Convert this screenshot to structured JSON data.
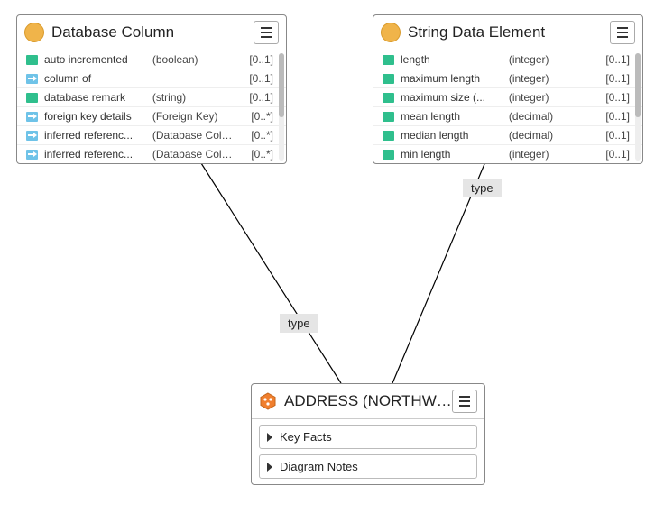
{
  "nodes": {
    "dbcol": {
      "title": "Database Column",
      "rows": [
        {
          "icon": "attr",
          "name": "auto incremented",
          "dtype": "(boolean)",
          "card": "[0..1]"
        },
        {
          "icon": "ref",
          "name": "column of",
          "dtype": "",
          "card": "[0..1]"
        },
        {
          "icon": "attr",
          "name": "database remark",
          "dtype": "(string)",
          "card": "[0..1]"
        },
        {
          "icon": "ref",
          "name": "foreign key details",
          "dtype": "(Foreign Key)",
          "card": "[0..*]"
        },
        {
          "icon": "ref",
          "name": "inferred referenc...",
          "dtype": "(Database Colu...",
          "card": "[0..*]"
        },
        {
          "icon": "ref",
          "name": "inferred referenc...",
          "dtype": "(Database Colu...",
          "card": "[0..*]"
        }
      ]
    },
    "strelem": {
      "title": "String Data Element",
      "rows": [
        {
          "icon": "attr",
          "name": "length",
          "dtype": "(integer)",
          "card": "[0..1]"
        },
        {
          "icon": "attr",
          "name": "maximum length",
          "dtype": "(integer)",
          "card": "[0..1]"
        },
        {
          "icon": "attr",
          "name": "maximum size (...",
          "dtype": "(integer)",
          "card": "[0..1]"
        },
        {
          "icon": "attr",
          "name": "mean length",
          "dtype": "(decimal)",
          "card": "[0..1]"
        },
        {
          "icon": "attr",
          "name": "median length",
          "dtype": "(decimal)",
          "card": "[0..1]"
        },
        {
          "icon": "attr",
          "name": "min length",
          "dtype": "(integer)",
          "card": "[0..1]"
        }
      ]
    },
    "address": {
      "title": "ADDRESS (NORTHWIN...",
      "sections": [
        "Key Facts",
        "Diagram Notes"
      ]
    }
  },
  "edges": {
    "left_label": "type",
    "right_label": "type"
  }
}
